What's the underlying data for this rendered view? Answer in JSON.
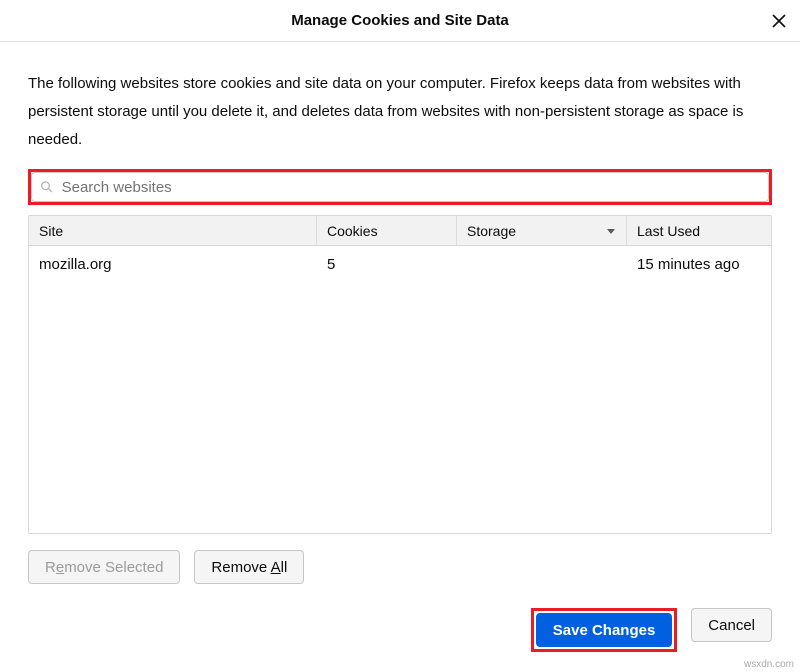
{
  "dialog": {
    "title": "Manage Cookies and Site Data",
    "description": "The following websites store cookies and site data on your computer. Firefox keeps data from websites with persistent storage until you delete it, and deletes data from websites with non-persistent storage as space is needed."
  },
  "search": {
    "placeholder": "Search websites",
    "value": ""
  },
  "columns": {
    "site": "Site",
    "cookies": "Cookies",
    "storage": "Storage",
    "last_used": "Last Used"
  },
  "rows": [
    {
      "site": "mozilla.org",
      "cookies": "5",
      "storage": "",
      "last_used": "15 minutes ago"
    }
  ],
  "buttons": {
    "remove_selected_pre": "R",
    "remove_selected_u": "e",
    "remove_selected_post": "move Selected",
    "remove_all_pre": "Remove ",
    "remove_all_u": "A",
    "remove_all_post": "ll",
    "save": "Save Changes",
    "cancel": "Cancel"
  },
  "watermark": "wsxdn.com"
}
